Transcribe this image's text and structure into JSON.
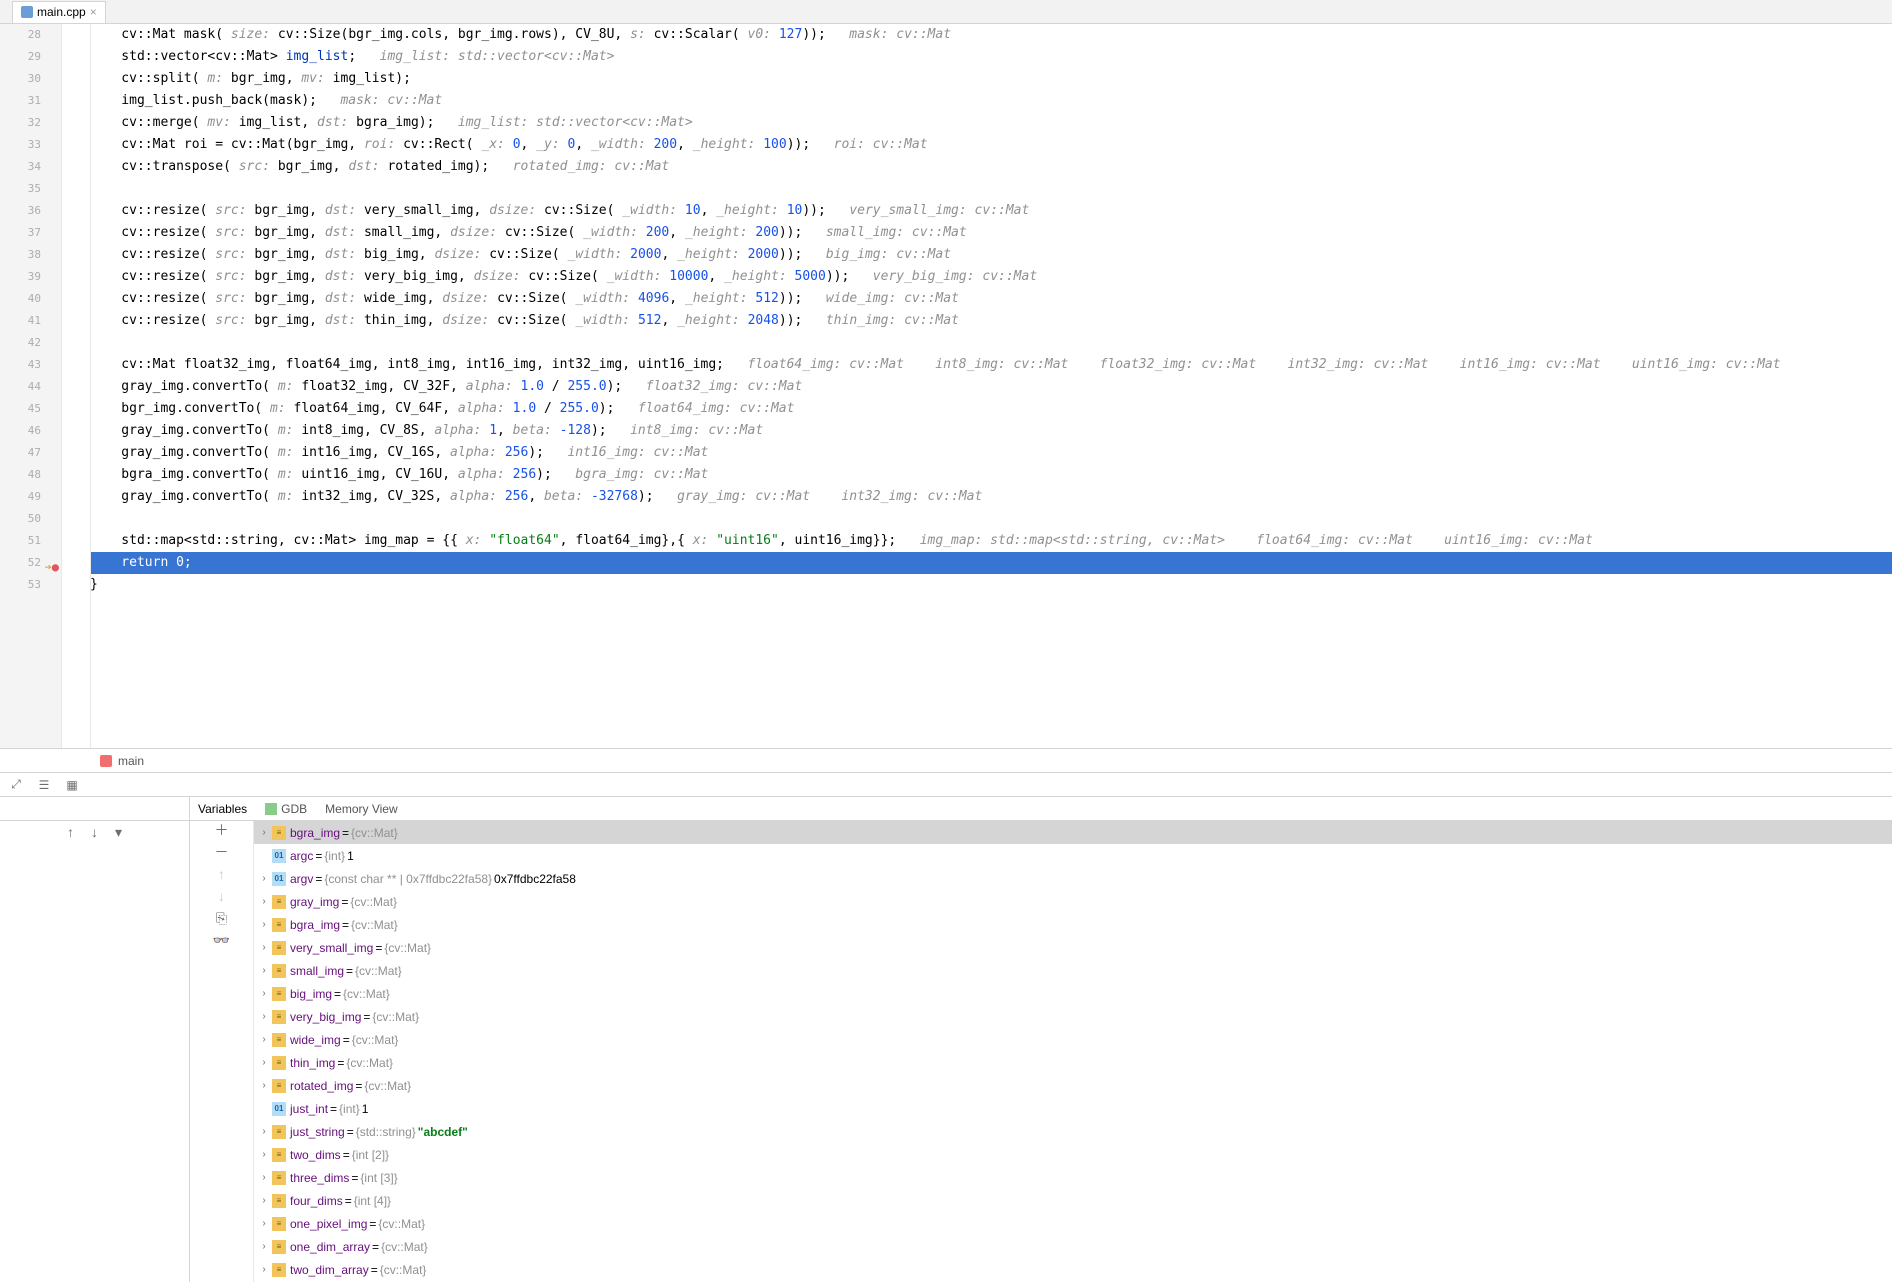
{
  "tab": {
    "filename": "main.cpp"
  },
  "breadcrumb": {
    "label": "main"
  },
  "gutter": {
    "start": 28,
    "end": 53,
    "breakpoint_line": 52
  },
  "code_lines": [
    {
      "n": 28,
      "segs": [
        [
          "ns",
          "    cv::"
        ],
        [
          "ident",
          "Mat mask( "
        ],
        [
          "param",
          "size: "
        ],
        [
          "ns",
          "cv::"
        ],
        [
          "ident",
          "Size(bgr_img.cols, bgr_img.rows), CV_8U, "
        ],
        [
          "param",
          "s: "
        ],
        [
          "ns",
          "cv::"
        ],
        [
          "ident",
          "Scalar( "
        ],
        [
          "param",
          "v0: "
        ],
        [
          "num",
          "127"
        ],
        [
          "ident",
          "));   "
        ],
        [
          "hint",
          "mask: cv::Mat"
        ]
      ]
    },
    {
      "n": 29,
      "segs": [
        [
          "ns",
          "    std::"
        ],
        [
          "ident",
          "vector<"
        ],
        [
          "ns",
          "cv::"
        ],
        [
          "ident",
          "Mat> "
        ],
        [
          "kw",
          "img_list"
        ],
        [
          "ident",
          ";   "
        ],
        [
          "hint",
          "img_list: std::vector<cv::Mat>"
        ]
      ]
    },
    {
      "n": 30,
      "segs": [
        [
          "ns",
          "    cv::"
        ],
        [
          "ident",
          "split( "
        ],
        [
          "param",
          "m: "
        ],
        [
          "ident",
          "bgr_img, "
        ],
        [
          "param",
          "mv: "
        ],
        [
          "ident",
          "img_list);"
        ]
      ]
    },
    {
      "n": 31,
      "segs": [
        [
          "ident",
          "    img_list.push_back(mask);   "
        ],
        [
          "hint",
          "mask: cv::Mat"
        ]
      ]
    },
    {
      "n": 32,
      "segs": [
        [
          "ns",
          "    cv::"
        ],
        [
          "ident",
          "merge( "
        ],
        [
          "param",
          "mv: "
        ],
        [
          "ident",
          "img_list, "
        ],
        [
          "param",
          "dst: "
        ],
        [
          "ident",
          "bgra_img);   "
        ],
        [
          "hint",
          "img_list: std::vector<cv::Mat>"
        ]
      ]
    },
    {
      "n": 33,
      "segs": [
        [
          "ns",
          "    cv::"
        ],
        [
          "ident",
          "Mat roi = "
        ],
        [
          "ns",
          "cv::"
        ],
        [
          "ident",
          "Mat(bgr_img, "
        ],
        [
          "param",
          "roi: "
        ],
        [
          "ns",
          "cv::"
        ],
        [
          "ident",
          "Rect( "
        ],
        [
          "param",
          "_x: "
        ],
        [
          "num",
          "0"
        ],
        [
          "ident",
          ", "
        ],
        [
          "param",
          "_y: "
        ],
        [
          "num",
          "0"
        ],
        [
          "ident",
          ", "
        ],
        [
          "param",
          "_width: "
        ],
        [
          "num",
          "200"
        ],
        [
          "ident",
          ", "
        ],
        [
          "param",
          "_height: "
        ],
        [
          "num",
          "100"
        ],
        [
          "ident",
          "));   "
        ],
        [
          "hint",
          "roi: cv::Mat"
        ]
      ]
    },
    {
      "n": 34,
      "segs": [
        [
          "ns",
          "    cv::"
        ],
        [
          "ident",
          "transpose( "
        ],
        [
          "param",
          "src: "
        ],
        [
          "ident",
          "bgr_img, "
        ],
        [
          "param",
          "dst: "
        ],
        [
          "ident",
          "rotated_img);   "
        ],
        [
          "hint",
          "rotated_img: cv::Mat"
        ]
      ]
    },
    {
      "n": 35,
      "segs": [
        [
          "ident",
          " "
        ]
      ]
    },
    {
      "n": 36,
      "segs": [
        [
          "ns",
          "    cv::"
        ],
        [
          "ident",
          "resize( "
        ],
        [
          "param",
          "src: "
        ],
        [
          "ident",
          "bgr_img, "
        ],
        [
          "param",
          "dst: "
        ],
        [
          "ident",
          "very_small_img, "
        ],
        [
          "param",
          "dsize: "
        ],
        [
          "ns",
          "cv::"
        ],
        [
          "ident",
          "Size( "
        ],
        [
          "param",
          "_width: "
        ],
        [
          "num",
          "10"
        ],
        [
          "ident",
          ", "
        ],
        [
          "param",
          "_height: "
        ],
        [
          "num",
          "10"
        ],
        [
          "ident",
          "));   "
        ],
        [
          "hint",
          "very_small_img: cv::Mat"
        ]
      ]
    },
    {
      "n": 37,
      "segs": [
        [
          "ns",
          "    cv::"
        ],
        [
          "ident",
          "resize( "
        ],
        [
          "param",
          "src: "
        ],
        [
          "ident",
          "bgr_img, "
        ],
        [
          "param",
          "dst: "
        ],
        [
          "ident",
          "small_img, "
        ],
        [
          "param",
          "dsize: "
        ],
        [
          "ns",
          "cv::"
        ],
        [
          "ident",
          "Size( "
        ],
        [
          "param",
          "_width: "
        ],
        [
          "num",
          "200"
        ],
        [
          "ident",
          ", "
        ],
        [
          "param",
          "_height: "
        ],
        [
          "num",
          "200"
        ],
        [
          "ident",
          "));   "
        ],
        [
          "hint",
          "small_img: cv::Mat"
        ]
      ]
    },
    {
      "n": 38,
      "segs": [
        [
          "ns",
          "    cv::"
        ],
        [
          "ident",
          "resize( "
        ],
        [
          "param",
          "src: "
        ],
        [
          "ident",
          "bgr_img, "
        ],
        [
          "param",
          "dst: "
        ],
        [
          "ident",
          "big_img, "
        ],
        [
          "param",
          "dsize: "
        ],
        [
          "ns",
          "cv::"
        ],
        [
          "ident",
          "Size( "
        ],
        [
          "param",
          "_width: "
        ],
        [
          "num",
          "2000"
        ],
        [
          "ident",
          ", "
        ],
        [
          "param",
          "_height: "
        ],
        [
          "num",
          "2000"
        ],
        [
          "ident",
          "));   "
        ],
        [
          "hint",
          "big_img: cv::Mat"
        ]
      ]
    },
    {
      "n": 39,
      "segs": [
        [
          "ns",
          "    cv::"
        ],
        [
          "ident",
          "resize( "
        ],
        [
          "param",
          "src: "
        ],
        [
          "ident",
          "bgr_img, "
        ],
        [
          "param",
          "dst: "
        ],
        [
          "ident",
          "very_big_img, "
        ],
        [
          "param",
          "dsize: "
        ],
        [
          "ns",
          "cv::"
        ],
        [
          "ident",
          "Size( "
        ],
        [
          "param",
          "_width: "
        ],
        [
          "num",
          "10000"
        ],
        [
          "ident",
          ", "
        ],
        [
          "param",
          "_height: "
        ],
        [
          "num",
          "5000"
        ],
        [
          "ident",
          "));   "
        ],
        [
          "hint",
          "very_big_img: cv::Mat"
        ]
      ]
    },
    {
      "n": 40,
      "segs": [
        [
          "ns",
          "    cv::"
        ],
        [
          "ident",
          "resize( "
        ],
        [
          "param",
          "src: "
        ],
        [
          "ident",
          "bgr_img, "
        ],
        [
          "param",
          "dst: "
        ],
        [
          "ident",
          "wide_img, "
        ],
        [
          "param",
          "dsize: "
        ],
        [
          "ns",
          "cv::"
        ],
        [
          "ident",
          "Size( "
        ],
        [
          "param",
          "_width: "
        ],
        [
          "num",
          "4096"
        ],
        [
          "ident",
          ", "
        ],
        [
          "param",
          "_height: "
        ],
        [
          "num",
          "512"
        ],
        [
          "ident",
          "));   "
        ],
        [
          "hint",
          "wide_img: cv::Mat"
        ]
      ]
    },
    {
      "n": 41,
      "segs": [
        [
          "ns",
          "    cv::"
        ],
        [
          "ident",
          "resize( "
        ],
        [
          "param",
          "src: "
        ],
        [
          "ident",
          "bgr_img, "
        ],
        [
          "param",
          "dst: "
        ],
        [
          "ident",
          "thin_img, "
        ],
        [
          "param",
          "dsize: "
        ],
        [
          "ns",
          "cv::"
        ],
        [
          "ident",
          "Size( "
        ],
        [
          "param",
          "_width: "
        ],
        [
          "num",
          "512"
        ],
        [
          "ident",
          ", "
        ],
        [
          "param",
          "_height: "
        ],
        [
          "num",
          "2048"
        ],
        [
          "ident",
          "));   "
        ],
        [
          "hint",
          "thin_img: cv::Mat"
        ]
      ]
    },
    {
      "n": 42,
      "segs": [
        [
          "ident",
          " "
        ]
      ]
    },
    {
      "n": 43,
      "segs": [
        [
          "ns",
          "    cv::"
        ],
        [
          "ident",
          "Mat float32_img, float64_img, int8_img, int16_img, int32_img, uint16_img;   "
        ],
        [
          "hint",
          "float64_img: cv::Mat    int8_img: cv::Mat    float32_img: cv::Mat    int32_img: cv::Mat    int16_img: cv::Mat    uint16_img: cv::Mat"
        ]
      ]
    },
    {
      "n": 44,
      "segs": [
        [
          "ident",
          "    gray_img.convertTo( "
        ],
        [
          "param",
          "m: "
        ],
        [
          "ident",
          "float32_img, CV_32F, "
        ],
        [
          "param",
          "alpha: "
        ],
        [
          "num",
          "1.0"
        ],
        [
          "ident",
          " / "
        ],
        [
          "num",
          "255.0"
        ],
        [
          "ident",
          ");   "
        ],
        [
          "hint",
          "float32_img: cv::Mat"
        ]
      ]
    },
    {
      "n": 45,
      "segs": [
        [
          "ident",
          "    bgr_img.convertTo( "
        ],
        [
          "param",
          "m: "
        ],
        [
          "ident",
          "float64_img, CV_64F, "
        ],
        [
          "param",
          "alpha: "
        ],
        [
          "num",
          "1.0"
        ],
        [
          "ident",
          " / "
        ],
        [
          "num",
          "255.0"
        ],
        [
          "ident",
          ");   "
        ],
        [
          "hint",
          "float64_img: cv::Mat"
        ]
      ]
    },
    {
      "n": 46,
      "segs": [
        [
          "ident",
          "    gray_img.convertTo( "
        ],
        [
          "param",
          "m: "
        ],
        [
          "ident",
          "int8_img, CV_8S, "
        ],
        [
          "param",
          "alpha: "
        ],
        [
          "num",
          "1"
        ],
        [
          "ident",
          ", "
        ],
        [
          "param",
          "beta: "
        ],
        [
          "num",
          "-128"
        ],
        [
          "ident",
          ");   "
        ],
        [
          "hint",
          "int8_img: cv::Mat"
        ]
      ]
    },
    {
      "n": 47,
      "segs": [
        [
          "ident",
          "    gray_img.convertTo( "
        ],
        [
          "param",
          "m: "
        ],
        [
          "ident",
          "int16_img, CV_16S, "
        ],
        [
          "param",
          "alpha: "
        ],
        [
          "num",
          "256"
        ],
        [
          "ident",
          ");   "
        ],
        [
          "hint",
          "int16_img: cv::Mat"
        ]
      ]
    },
    {
      "n": 48,
      "segs": [
        [
          "ident",
          "    bgra_img.convertTo( "
        ],
        [
          "param",
          "m: "
        ],
        [
          "ident",
          "uint16_img, CV_16U, "
        ],
        [
          "param",
          "alpha: "
        ],
        [
          "num",
          "256"
        ],
        [
          "ident",
          ");   "
        ],
        [
          "hint",
          "bgra_img: cv::Mat"
        ]
      ]
    },
    {
      "n": 49,
      "segs": [
        [
          "ident",
          "    gray_img.convertTo( "
        ],
        [
          "param",
          "m: "
        ],
        [
          "ident",
          "int32_img, CV_32S, "
        ],
        [
          "param",
          "alpha: "
        ],
        [
          "num",
          "256"
        ],
        [
          "ident",
          ", "
        ],
        [
          "param",
          "beta: "
        ],
        [
          "num",
          "-32768"
        ],
        [
          "ident",
          ");   "
        ],
        [
          "hint",
          "gray_img: cv::Mat    int32_img: cv::Mat"
        ]
      ]
    },
    {
      "n": 50,
      "segs": [
        [
          "ident",
          " "
        ]
      ]
    },
    {
      "n": 51,
      "segs": [
        [
          "ns",
          "    std::"
        ],
        [
          "ident",
          "map<"
        ],
        [
          "ns",
          "std::"
        ],
        [
          "ident",
          "string, "
        ],
        [
          "ns",
          "cv::"
        ],
        [
          "ident",
          "Mat> img_map = {{ "
        ],
        [
          "param",
          "x: "
        ],
        [
          "str",
          "\"float64\""
        ],
        [
          "ident",
          ", float64_img},{ "
        ],
        [
          "param",
          "x: "
        ],
        [
          "str",
          "\"uint16\""
        ],
        [
          "ident",
          ", uint16_img}};   "
        ],
        [
          "hint",
          "img_map: std::map<std::string, cv::Mat>    float64_img: cv::Mat    uint16_img: cv::Mat"
        ]
      ]
    },
    {
      "n": 52,
      "highlighted": true,
      "segs": [
        [
          "kw",
          "    return "
        ],
        [
          "num",
          "0"
        ],
        [
          "ident",
          ";"
        ]
      ]
    },
    {
      "n": 53,
      "segs": [
        [
          "ident",
          "}"
        ]
      ]
    }
  ],
  "debug_tabs": {
    "variables": "Variables",
    "gdb": "GDB",
    "memory": "Memory View"
  },
  "variables": [
    {
      "exp": true,
      "selected": true,
      "badge": "obj",
      "name": "bgra_img",
      "type": "{cv::Mat}",
      "val": ""
    },
    {
      "exp": false,
      "badge": "prim",
      "name": "argc",
      "type": "{int}",
      "val": " 1"
    },
    {
      "exp": true,
      "badge": "prim",
      "name": "argv",
      "type": "{const char ** | 0x7ffdbc22fa58}",
      "val": " 0x7ffdbc22fa58"
    },
    {
      "exp": true,
      "badge": "obj",
      "name": "gray_img",
      "type": "{cv::Mat}",
      "val": ""
    },
    {
      "exp": true,
      "badge": "obj",
      "name": "bgra_img",
      "type": "{cv::Mat}",
      "val": ""
    },
    {
      "exp": true,
      "badge": "obj",
      "name": "very_small_img",
      "type": "{cv::Mat}",
      "val": ""
    },
    {
      "exp": true,
      "badge": "obj",
      "name": "small_img",
      "type": "{cv::Mat}",
      "val": ""
    },
    {
      "exp": true,
      "badge": "obj",
      "name": "big_img",
      "type": "{cv::Mat}",
      "val": ""
    },
    {
      "exp": true,
      "badge": "obj",
      "name": "very_big_img",
      "type": "{cv::Mat}",
      "val": ""
    },
    {
      "exp": true,
      "badge": "obj",
      "name": "wide_img",
      "type": "{cv::Mat}",
      "val": ""
    },
    {
      "exp": true,
      "badge": "obj",
      "name": "thin_img",
      "type": "{cv::Mat}",
      "val": ""
    },
    {
      "exp": true,
      "badge": "obj",
      "name": "rotated_img",
      "type": "{cv::Mat}",
      "val": ""
    },
    {
      "exp": false,
      "badge": "prim",
      "name": "just_int",
      "type": "{int}",
      "val": " 1"
    },
    {
      "exp": true,
      "badge": "obj",
      "name": "just_string",
      "type": "{std::string}",
      "val": " \"abcdef\"",
      "strval": true
    },
    {
      "exp": true,
      "badge": "obj",
      "name": "two_dims",
      "type": "{int [2]}",
      "val": ""
    },
    {
      "exp": true,
      "badge": "obj",
      "name": "three_dims",
      "type": "{int [3]}",
      "val": ""
    },
    {
      "exp": true,
      "badge": "obj",
      "name": "four_dims",
      "type": "{int [4]}",
      "val": ""
    },
    {
      "exp": true,
      "badge": "obj",
      "name": "one_pixel_img",
      "type": "{cv::Mat}",
      "val": ""
    },
    {
      "exp": true,
      "badge": "obj",
      "name": "one_dim_array",
      "type": "{cv::Mat}",
      "val": ""
    },
    {
      "exp": true,
      "badge": "obj",
      "name": "two_dim_array",
      "type": "{cv::Mat}",
      "val": ""
    }
  ],
  "icons": {
    "arrow_up": "↑",
    "arrow_down": "↓",
    "plus": "＋",
    "minus": "－",
    "frames": "☰",
    "threads": "⛶",
    "filter": "⚙"
  }
}
